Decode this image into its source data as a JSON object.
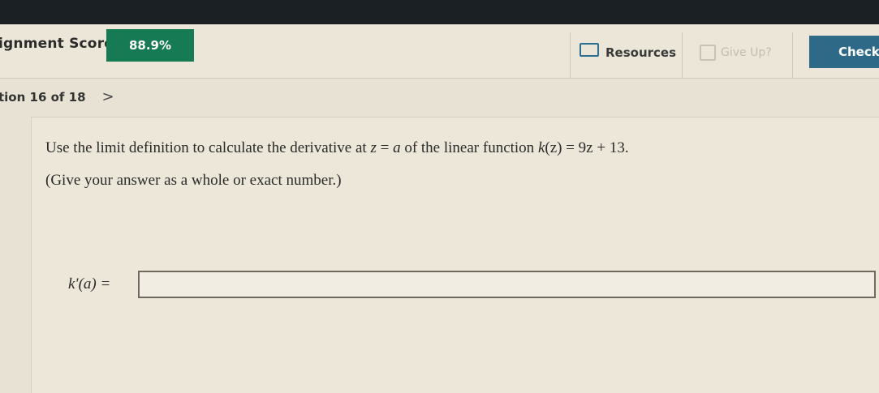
{
  "header": {
    "score_label": "ignment Score:",
    "score_value": "88.9%",
    "resources_label": "Resources",
    "giveup_label": "Give Up?",
    "check_label": "Check"
  },
  "nav": {
    "question_progress": "tion 16 of 18",
    "next_glyph": ">"
  },
  "question": {
    "p1": "Use the limit definition to calculate the derivative at ",
    "z": "z",
    "eq": " = ",
    "a": "a",
    "p2": " of the linear function ",
    "k": "k",
    "arg": "(z)",
    "eq2": " = 9z + 13.",
    "instruction": "(Give your answer as a whole or exact number.)"
  },
  "answer": {
    "label": "k′(a) =",
    "value": ""
  },
  "colors": {
    "score_badge": "#167a55",
    "check_button": "#2e6a87",
    "top_bar": "#1a2024"
  }
}
